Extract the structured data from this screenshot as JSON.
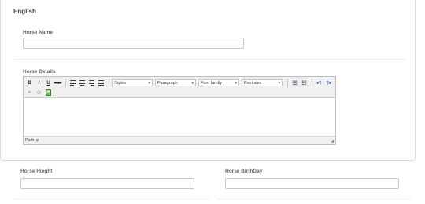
{
  "section": {
    "title": "English"
  },
  "horse_name": {
    "label": "Horse Name",
    "value": ""
  },
  "horse_details": {
    "label": "Horse Details",
    "toolbar": {
      "bold": "B",
      "italic": "I",
      "underline": "U",
      "strike": "ABC",
      "styles": "Styles",
      "paragraph": "Paragraph",
      "font_family": "Font family",
      "font_size": "Font size",
      "ltr": "▸¶",
      "rtl": "¶◂"
    },
    "path": "Path: p"
  },
  "horse_height": {
    "label": "Horse Hieght",
    "value": ""
  },
  "horse_birthday": {
    "label": "Horse BirthDay",
    "value": ""
  },
  "icons": [
    "bold-icon",
    "italic-icon",
    "underline-icon",
    "strikethrough-icon",
    "align-left-icon",
    "align-center-icon",
    "align-right-icon",
    "align-justify-icon",
    "bullet-list-icon",
    "numbered-list-icon",
    "ltr-icon",
    "rtl-icon",
    "link-icon",
    "unlink-icon",
    "image-icon",
    "resize-handle-icon"
  ]
}
